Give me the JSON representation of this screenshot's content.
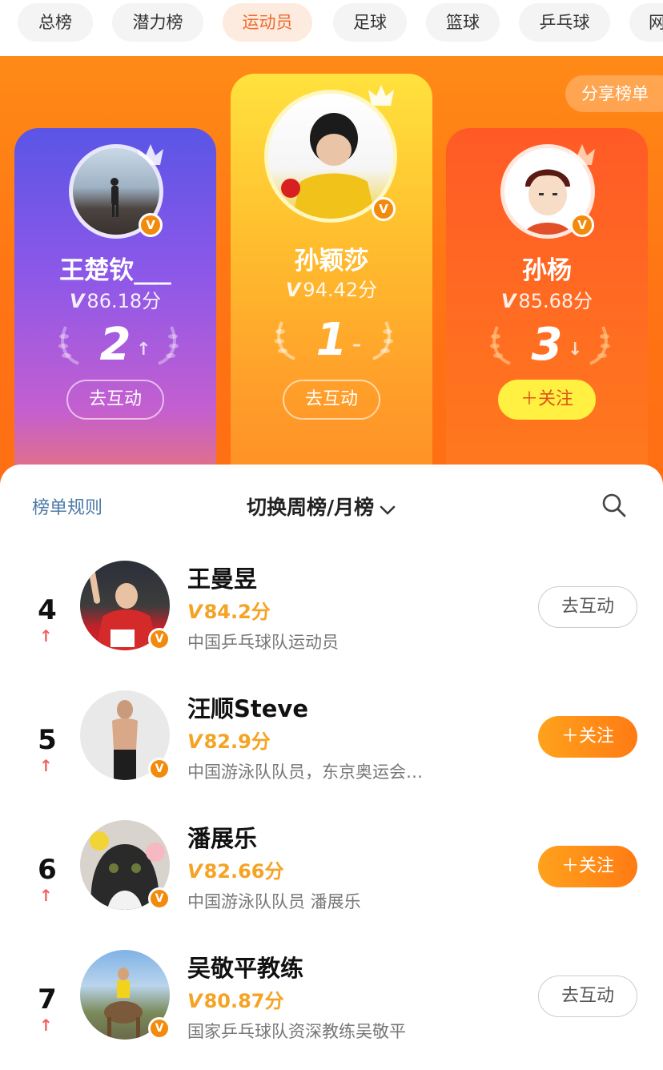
{
  "tabs": [
    "总榜",
    "潜力榜",
    "运动员",
    "足球",
    "篮球",
    "乒乓球",
    "网"
  ],
  "active_tab": "运动员",
  "share_label": "分享榜单",
  "colors": {
    "accent": "#ff7414",
    "score_gold": "#f5a324",
    "trend_up": "#f06060",
    "rules_link": "#4d7aa6"
  },
  "podium": {
    "first": {
      "name": "孙颖莎",
      "score_v": "V",
      "score": "94.42分",
      "rank": "1",
      "trend": "–",
      "button": "去互动"
    },
    "second": {
      "name": "王楚钦___",
      "score_v": "V",
      "score": "86.18分",
      "rank": "2",
      "trend": "↑",
      "button": "去互动"
    },
    "third": {
      "name": "孙杨",
      "score_v": "V",
      "score": "85.68分",
      "rank": "3",
      "trend": "↓",
      "button": "＋关注"
    }
  },
  "panel": {
    "rules_label": "榜单规则",
    "switch_label": "切换周榜/月榜",
    "search_icon": "search-icon"
  },
  "list": [
    {
      "rank": "4",
      "trend": "↑",
      "name": "王曼昱",
      "score_v": "V",
      "score": "84.2分",
      "desc": "中国乒乓球队运动员",
      "button": "去互动",
      "button_type": "interact"
    },
    {
      "rank": "5",
      "trend": "↑",
      "name": "汪顺Steve",
      "score_v": "V",
      "score": "82.9分",
      "desc": "中国游泳队队员，东京奥运会…",
      "button": "＋关注",
      "button_type": "follow"
    },
    {
      "rank": "6",
      "trend": "↑",
      "name": "潘展乐",
      "score_v": "V",
      "score": "82.66分",
      "desc": "中国游泳队队员 潘展乐",
      "button": "＋关注",
      "button_type": "follow"
    },
    {
      "rank": "7",
      "trend": "↑",
      "name": "吴敬平教练",
      "score_v": "V",
      "score": "80.87分",
      "desc": "国家乒乓球队资深教练吴敬平",
      "button": "去互动",
      "button_type": "interact"
    }
  ]
}
